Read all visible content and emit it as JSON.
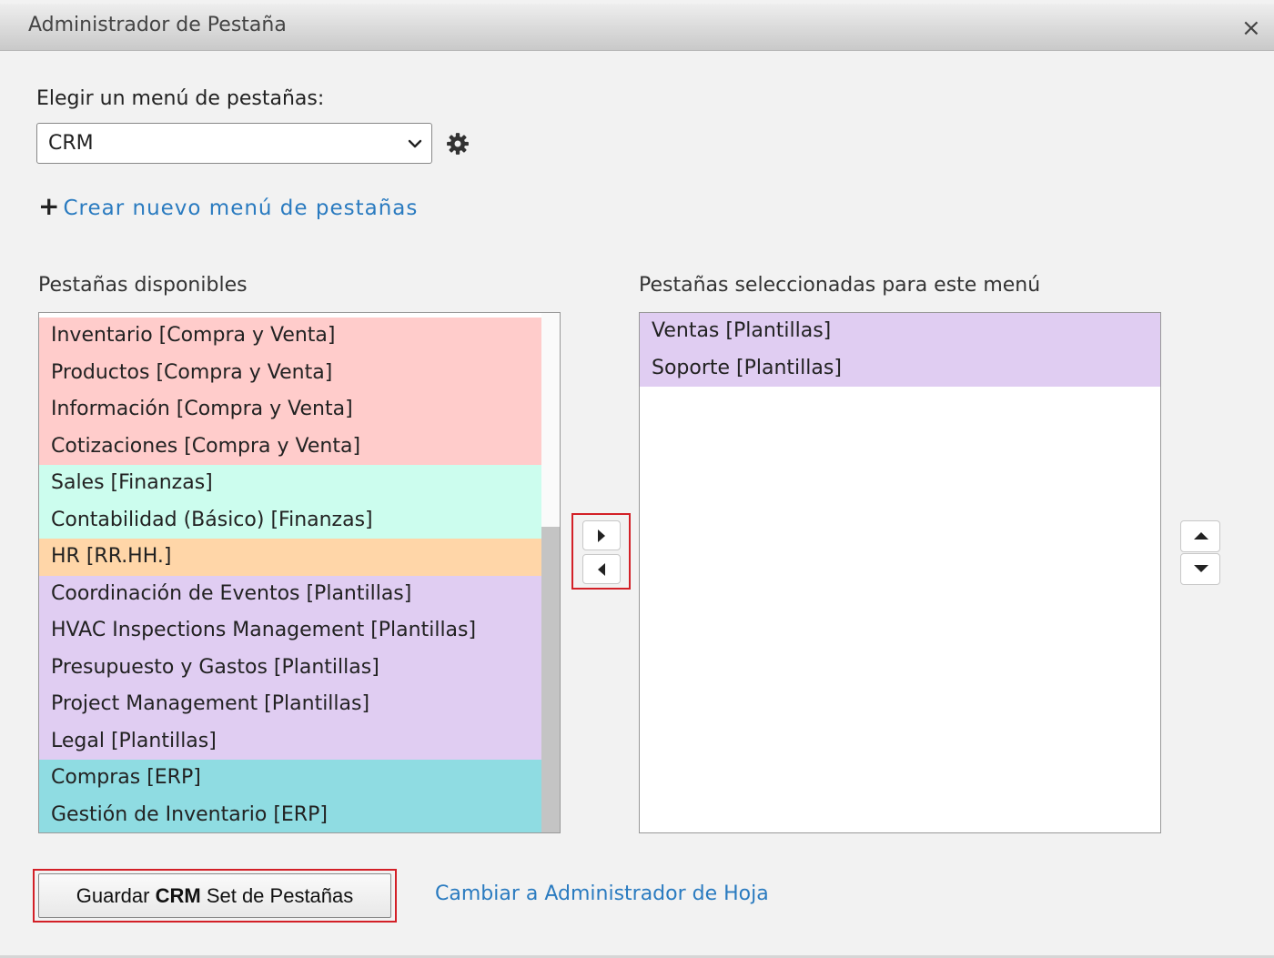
{
  "dialog": {
    "title": "Administrador de Pestaña",
    "close_label": "×"
  },
  "menu_select": {
    "label": "Elegir un menú de pestañas:",
    "value": "CRM"
  },
  "create_link": {
    "plus": "+",
    "label": "Crear nuevo menú de pestañas"
  },
  "available": {
    "label": "Pestañas disponibles",
    "items": [
      {
        "label": "Inventario [Compra y Venta]",
        "color": "#ffcccb"
      },
      {
        "label": "Productos [Compra y Venta]",
        "color": "#ffcccb"
      },
      {
        "label": "Información [Compra y Venta]",
        "color": "#ffcccb"
      },
      {
        "label": "Cotizaciones [Compra y Venta]",
        "color": "#ffcccb"
      },
      {
        "label": "Sales [Finanzas]",
        "color": "#ccfdee"
      },
      {
        "label": "Contabilidad (Básico) [Finanzas]",
        "color": "#ccfdee"
      },
      {
        "label": "HR [RR.HH.]",
        "color": "#ffd6a8"
      },
      {
        "label": "Coordinación de Eventos [Plantillas]",
        "color": "#e0cdf2"
      },
      {
        "label": "HVAC Inspections Management [Plantillas]",
        "color": "#e0cdf2"
      },
      {
        "label": "Presupuesto y Gastos [Plantillas]",
        "color": "#e0cdf2"
      },
      {
        "label": "Project Management [Plantillas]",
        "color": "#e0cdf2"
      },
      {
        "label": "Legal [Plantillas]",
        "color": "#e0cdf2"
      },
      {
        "label": "Compras [ERP]",
        "color": "#8fdce2"
      },
      {
        "label": "Gestión de Inventario [ERP]",
        "color": "#8fdce2"
      }
    ]
  },
  "selected": {
    "label": "Pestañas seleccionadas para este menú",
    "items": [
      {
        "label": "Ventas [Plantillas]",
        "color": "#e0cdf2"
      },
      {
        "label": "Soporte [Plantillas]",
        "color": "#e0cdf2"
      }
    ]
  },
  "footer": {
    "save_prefix": "Guardar",
    "save_bold": "CRM",
    "save_suffix": "Set de Pestañas",
    "switch_link": "Cambiar a Administrador de Hoja"
  },
  "icons": {
    "gear": "gear-icon",
    "chevron": "chevron-down-icon",
    "move_right": "caret-right-icon",
    "move_left": "caret-left-icon",
    "move_up": "caret-up-icon",
    "move_down": "caret-down-icon"
  },
  "colors": {
    "accent_link": "#2a7bc0",
    "highlight_border": "#d32027"
  }
}
